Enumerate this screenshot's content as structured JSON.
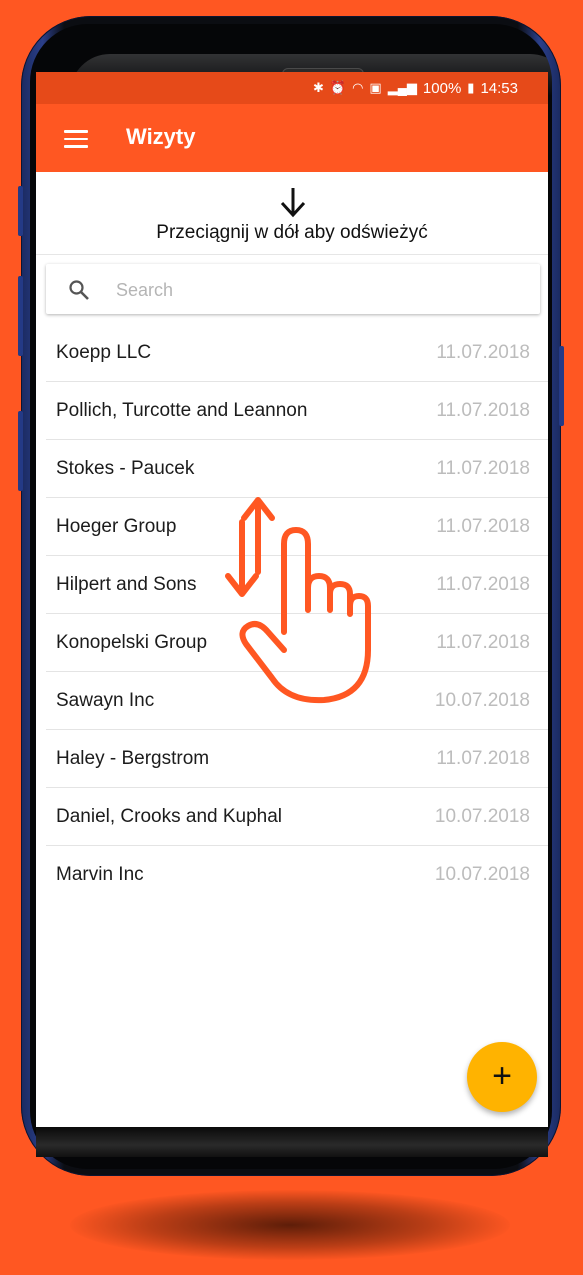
{
  "colors": {
    "background": "#ff5722",
    "statusbar": "#e64a19",
    "appbar": "#ff5722",
    "fab": "#ffb300",
    "date_text": "#bcbcbc"
  },
  "statusbar": {
    "icons": [
      "bluetooth-icon",
      "alarm-icon",
      "wifi-icon",
      "nfc-icon",
      "signal-icon",
      "battery-icon"
    ],
    "battery": "100%",
    "time": "14:53"
  },
  "appbar": {
    "menu_icon": "hamburger-menu-icon",
    "title": "Wizyty"
  },
  "refresh": {
    "icon": "arrow-down-icon",
    "text": "Przeciągnij w dół aby odświeżyć"
  },
  "search": {
    "icon": "search-icon",
    "placeholder": "Search",
    "value": ""
  },
  "visits": [
    {
      "name": "Koepp LLC",
      "date": "11.07.2018"
    },
    {
      "name": "Pollich, Turcotte and Leannon",
      "date": "11.07.2018"
    },
    {
      "name": "Stokes - Paucek",
      "date": "11.07.2018"
    },
    {
      "name": "Hoeger Group",
      "date": "11.07.2018"
    },
    {
      "name": "Hilpert and Sons",
      "date": "11.07.2018"
    },
    {
      "name": "Konopelski Group",
      "date": "11.07.2018"
    },
    {
      "name": "Sawayn Inc",
      "date": "10.07.2018"
    },
    {
      "name": "Haley - Bergstrom",
      "date": "11.07.2018"
    },
    {
      "name": "Daniel, Crooks and Kuphal",
      "date": "10.07.2018"
    },
    {
      "name": "Marvin Inc",
      "date": "10.07.2018"
    }
  ],
  "overlay": {
    "gesture_icon": "swipe-up-down-hand-icon"
  },
  "fab": {
    "label": "+",
    "icon": "add-icon"
  }
}
